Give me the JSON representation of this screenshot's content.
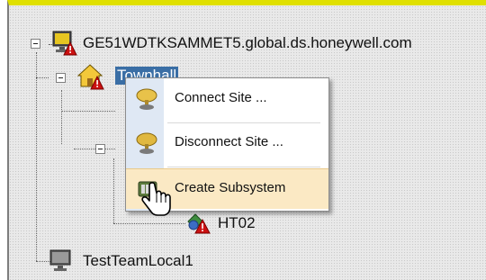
{
  "tree": {
    "nodes": [
      {
        "label": "GE51WDTKSAMMET5.global.ds.honeywell.com",
        "icon": "computer-alarm-icon"
      },
      {
        "label": "Townhall",
        "icon": "house-alarm-icon"
      },
      {
        "label": "HT02",
        "icon": "subsystem-alarm-icon"
      },
      {
        "label": "TestTeamLocal1",
        "icon": "computer-icon"
      }
    ]
  },
  "context_menu": {
    "items": [
      {
        "label": "Connect Site ...",
        "icon": "connect-site-icon"
      },
      {
        "label": "Disconnect Site ...",
        "icon": "disconnect-site-icon"
      },
      {
        "label": "Create Subsystem",
        "icon": "create-subsystem-icon"
      }
    ],
    "hover_color": "#fbe9c4"
  },
  "colors": {
    "accent_border": "#e0e000",
    "selection": "#3a6ea5",
    "alarm": "#cc1111"
  }
}
